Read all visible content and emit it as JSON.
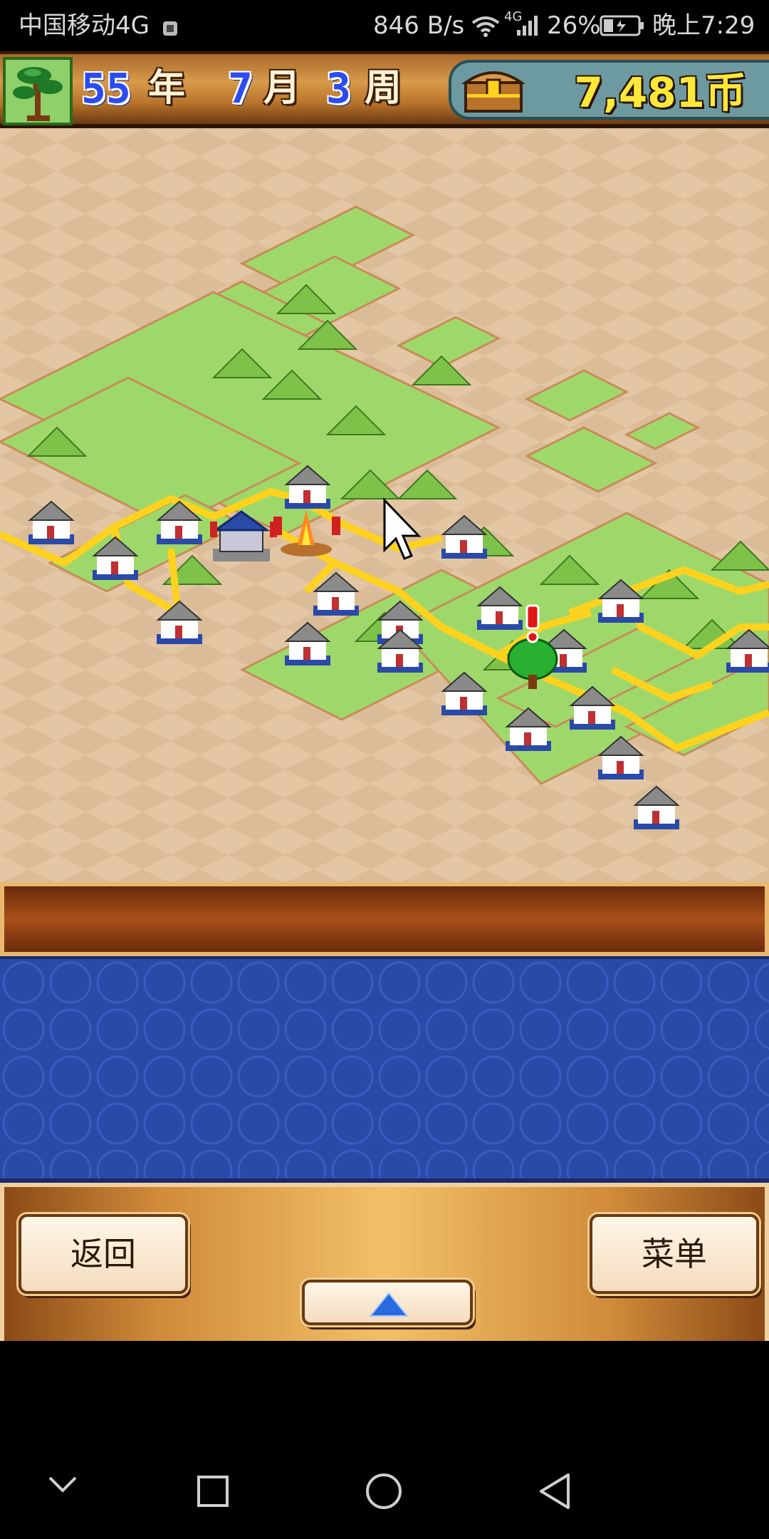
{
  "status_bar": {
    "carrier": "中国移动4G",
    "speed": "846 B/s",
    "network": "4G",
    "battery": "26%",
    "time": "晚上7:29"
  },
  "header": {
    "year": "55",
    "year_unit": "年",
    "month": "7",
    "month_unit": "月",
    "week": "3",
    "week_unit": "周",
    "coins": "7,481币"
  },
  "buttons": {
    "back": "返回",
    "menu": "菜单"
  },
  "icons": {
    "tree": "bonsai-tree-icon",
    "chest": "treasure-chest-icon",
    "cursor": "arrow-cursor-icon",
    "alert": "exclamation-icon",
    "expand": "triangle-up-icon"
  },
  "colors": {
    "year_digits": "#2a4cf0",
    "coins": "#ffe83a",
    "road": "#ffd21e",
    "grass": "#9fd86a",
    "sand": "#e3c6a4"
  }
}
